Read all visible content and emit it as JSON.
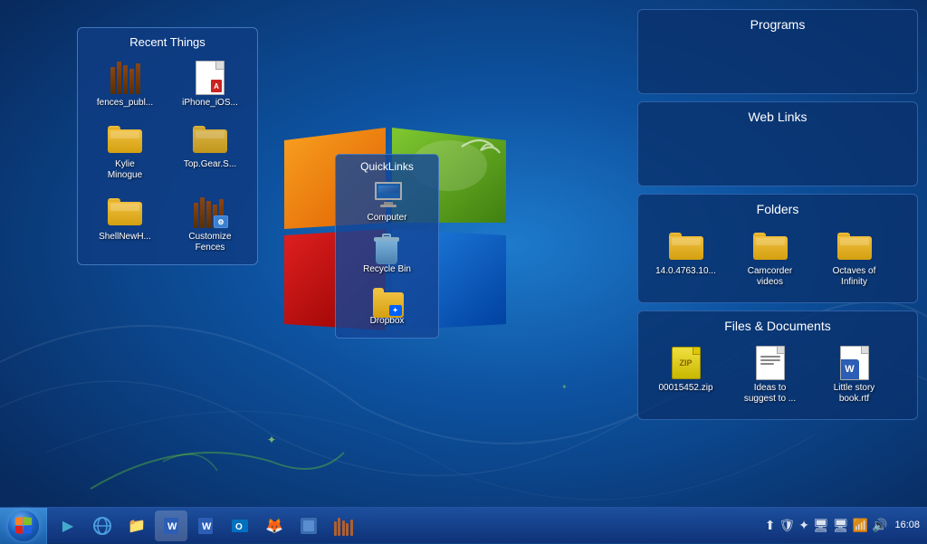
{
  "desktop": {
    "background": "blue gradient Windows 7"
  },
  "recent_things": {
    "title": "Recent Things",
    "items": [
      {
        "id": "fences",
        "label": "fences_publ...",
        "type": "fences"
      },
      {
        "id": "iphone",
        "label": "iPhone_iOS...",
        "type": "document"
      },
      {
        "id": "kylie",
        "label": "Kylie\nMinogue",
        "type": "folder"
      },
      {
        "id": "topgear",
        "label": "Top.Gear.S...",
        "type": "folder_open"
      },
      {
        "id": "shell",
        "label": "ShellNewH...",
        "type": "folder"
      },
      {
        "id": "customize",
        "label": "Customize\nFences",
        "type": "fences"
      }
    ]
  },
  "quicklinks": {
    "title": "QuickLinks",
    "items": [
      {
        "id": "computer",
        "label": "Computer",
        "type": "monitor"
      },
      {
        "id": "recycle",
        "label": "Recycle Bin",
        "type": "recycle"
      },
      {
        "id": "dropbox",
        "label": "Dropbox",
        "type": "dropbox"
      }
    ]
  },
  "right_panels": {
    "programs": {
      "title": "Programs",
      "items": []
    },
    "web_links": {
      "title": "Web Links",
      "items": []
    },
    "folders": {
      "title": "Folders",
      "items": [
        {
          "id": "folder1",
          "label": "14.0.4763.10...",
          "type": "folder"
        },
        {
          "id": "folder2",
          "label": "Camcorder\nvideos",
          "type": "folder"
        },
        {
          "id": "folder3",
          "label": "Octaves of\nInfinity",
          "type": "folder"
        }
      ]
    },
    "files_docs": {
      "title": "Files & Documents",
      "items": [
        {
          "id": "zip1",
          "label": "00015452.zip",
          "type": "zip"
        },
        {
          "id": "ideas",
          "label": "Ideas to\nsuggest to ...",
          "type": "document"
        },
        {
          "id": "story",
          "label": "Little story\nbook.rtf",
          "type": "word"
        }
      ]
    }
  },
  "taskbar": {
    "start_label": "⊞",
    "items": [
      {
        "id": "media",
        "icon": "▶",
        "label": "Media Player"
      },
      {
        "id": "ie",
        "icon": "e",
        "label": "Internet Explorer"
      },
      {
        "id": "explorer",
        "icon": "📁",
        "label": "Windows Explorer"
      },
      {
        "id": "word",
        "icon": "W",
        "label": "Word"
      },
      {
        "id": "word2",
        "icon": "W",
        "label": "Word 2"
      },
      {
        "id": "outlook",
        "icon": "O",
        "label": "Outlook"
      },
      {
        "id": "firefox",
        "icon": "🦊",
        "label": "Firefox"
      },
      {
        "id": "unknown",
        "icon": "⊞",
        "label": "App"
      },
      {
        "id": "fences",
        "icon": "|||",
        "label": "Fences"
      }
    ],
    "tray": {
      "icons": [
        "⬆",
        "🛡",
        "✦",
        "🖥",
        "🖥",
        "📶",
        "🔊"
      ],
      "time": "16:08"
    }
  }
}
